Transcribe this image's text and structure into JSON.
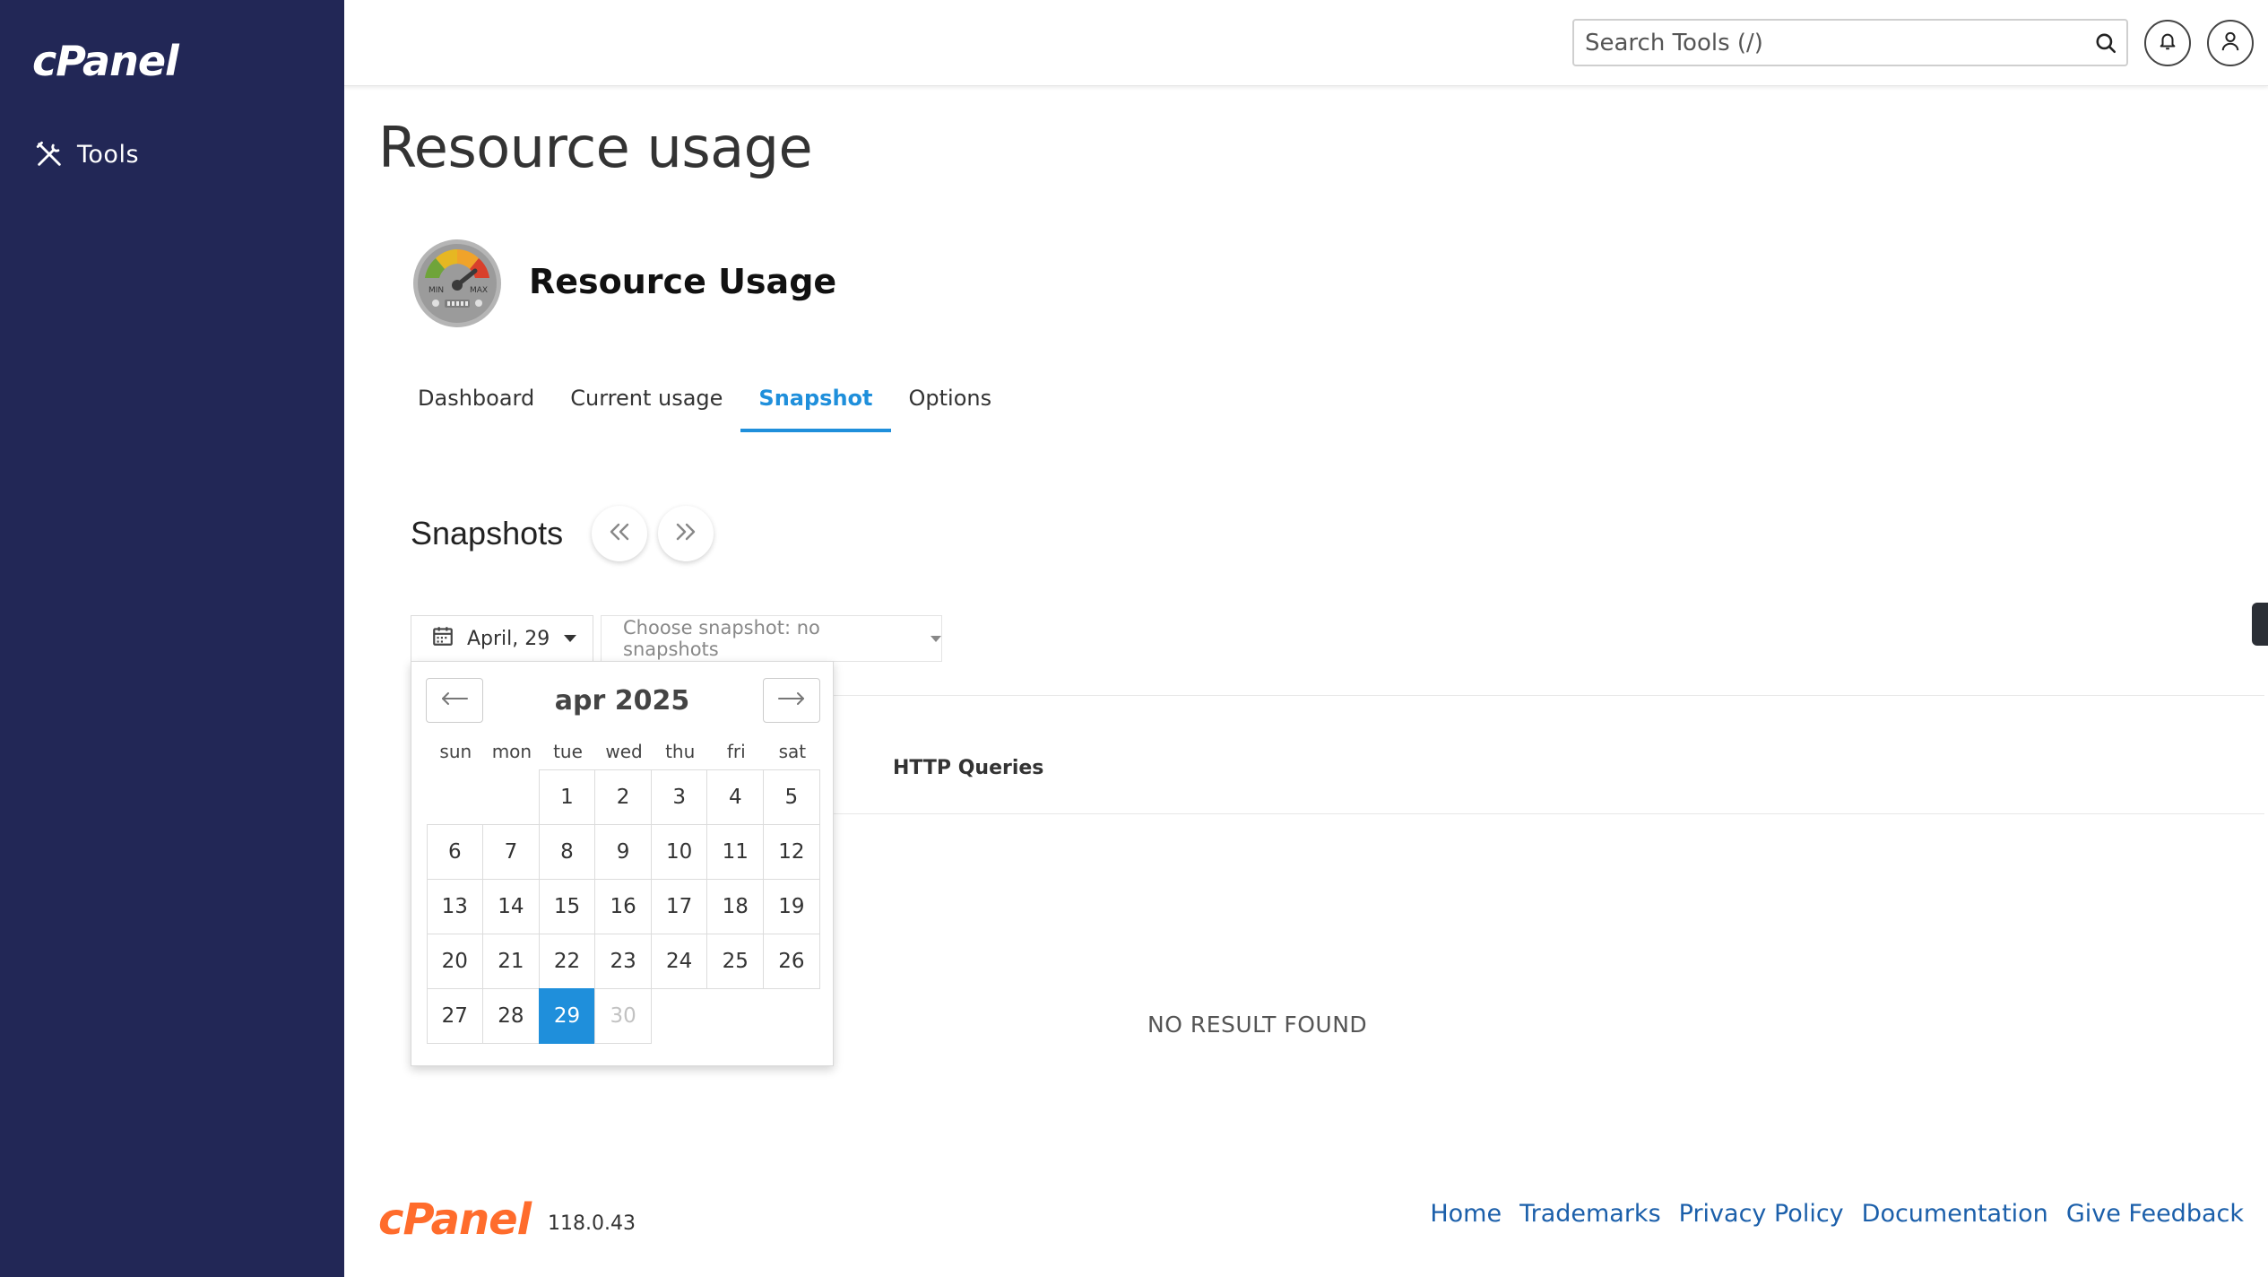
{
  "brand": {
    "logo_text": "cPanel",
    "sidebar_logo_color": "#ffffff",
    "footer_logo_color": "#ff6c2c",
    "version": "118.0.43"
  },
  "colors": {
    "sidebar_bg": "#222756",
    "accent": "#1f8fdb",
    "link": "#1b5faa"
  },
  "sidebar": {
    "items": [
      {
        "label": "Tools",
        "icon": "tools-icon"
      }
    ]
  },
  "header": {
    "search_placeholder": "Search Tools (/)",
    "icons": [
      "search-icon",
      "bell-icon",
      "user-icon"
    ]
  },
  "page": {
    "title": "Resource usage",
    "app_name": "Resource Usage",
    "gauge_min_label": "MIN",
    "gauge_max_label": "MAX"
  },
  "tabs": [
    {
      "label": "Dashboard",
      "active": false
    },
    {
      "label": "Current usage",
      "active": false
    },
    {
      "label": "Snapshot",
      "active": true
    },
    {
      "label": "Options",
      "active": false
    }
  ],
  "snapshots": {
    "title": "Snapshots",
    "date_label": "April, 29",
    "select_label": "Choose snapshot: no snapshots",
    "column_header": "HTTP Queries",
    "empty_text": "NO RESULT FOUND"
  },
  "datepicker": {
    "month_label": "apr 2025",
    "weekdays": [
      "sun",
      "mon",
      "tue",
      "wed",
      "thu",
      "fri",
      "sat"
    ],
    "leading_blanks": 2,
    "days": [
      "1",
      "2",
      "3",
      "4",
      "5",
      "6",
      "7",
      "8",
      "9",
      "10",
      "11",
      "12",
      "13",
      "14",
      "15",
      "16",
      "17",
      "18",
      "19",
      "20",
      "21",
      "22",
      "23",
      "24",
      "25",
      "26",
      "27",
      "28",
      "29",
      "30"
    ],
    "selected": "29",
    "disabled": [
      "30"
    ]
  },
  "footer": {
    "links": [
      "Home",
      "Trademarks",
      "Privacy Policy",
      "Documentation",
      "Give Feedback"
    ]
  }
}
